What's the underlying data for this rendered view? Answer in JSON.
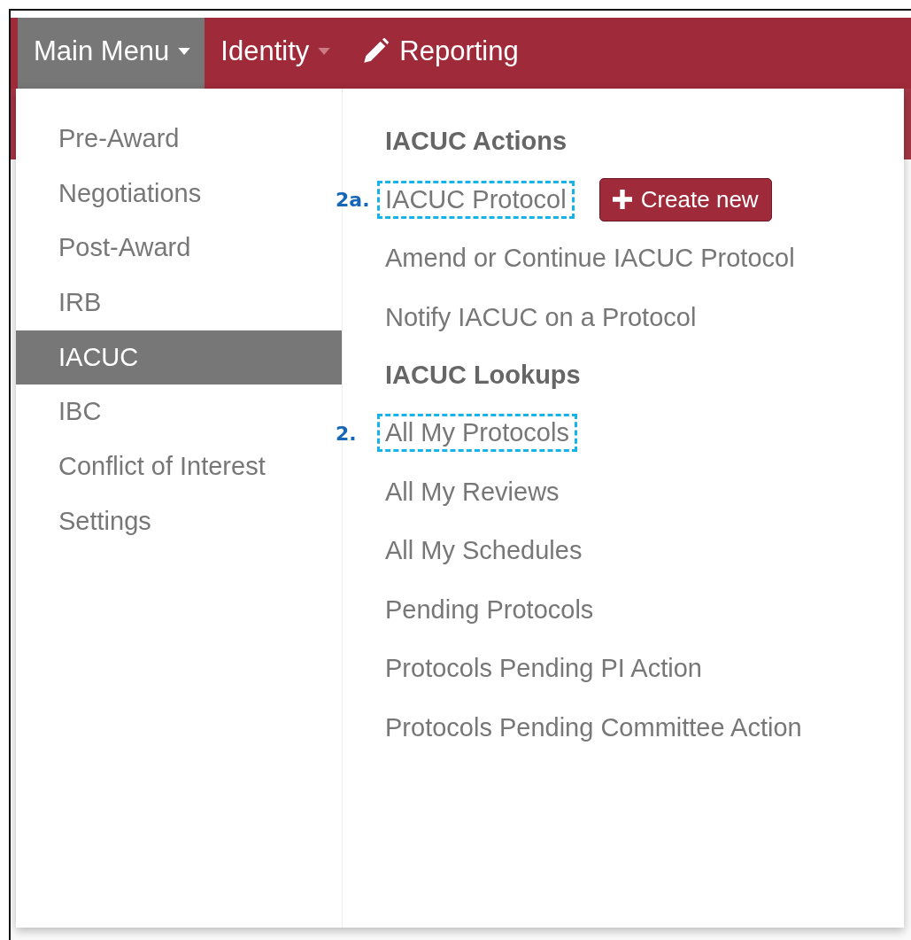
{
  "navbar": [
    {
      "kind": "dropdown",
      "label": "Main Menu",
      "selected": true
    },
    {
      "kind": "dropdown",
      "label": "Identity",
      "selected": false
    },
    {
      "kind": "tool",
      "label": "Reporting",
      "selected": false
    }
  ],
  "menu": {
    "left": [
      {
        "label": "Pre-Award",
        "selected": false
      },
      {
        "label": "Negotiations",
        "selected": false
      },
      {
        "label": "Post-Award",
        "selected": false
      },
      {
        "label": "IRB",
        "selected": false
      },
      {
        "label": "IACUC",
        "selected": true
      },
      {
        "label": "IBC",
        "selected": false
      },
      {
        "label": "Conflict of Interest",
        "selected": false
      },
      {
        "label": "Settings",
        "selected": false
      }
    ],
    "right": [
      {
        "kind": "header",
        "label": "IACUC Actions"
      },
      {
        "kind": "link",
        "label": "IACUC Protocol",
        "callout": "2a.",
        "button": "Create new"
      },
      {
        "kind": "link",
        "label": "Amend or Continue IACUC Protocol"
      },
      {
        "kind": "link",
        "label": "Notify IACUC on a Protocol"
      },
      {
        "kind": "header",
        "label": "IACUC Lookups"
      },
      {
        "kind": "link",
        "label": "All My Protocols",
        "callout": "2."
      },
      {
        "kind": "link",
        "label": "All My Reviews"
      },
      {
        "kind": "link",
        "label": "All My Schedules"
      },
      {
        "kind": "link",
        "label": "Pending Protocols"
      },
      {
        "kind": "link",
        "label": "Protocols Pending PI Action"
      },
      {
        "kind": "link",
        "label": "Protocols Pending Committee Action"
      }
    ]
  }
}
